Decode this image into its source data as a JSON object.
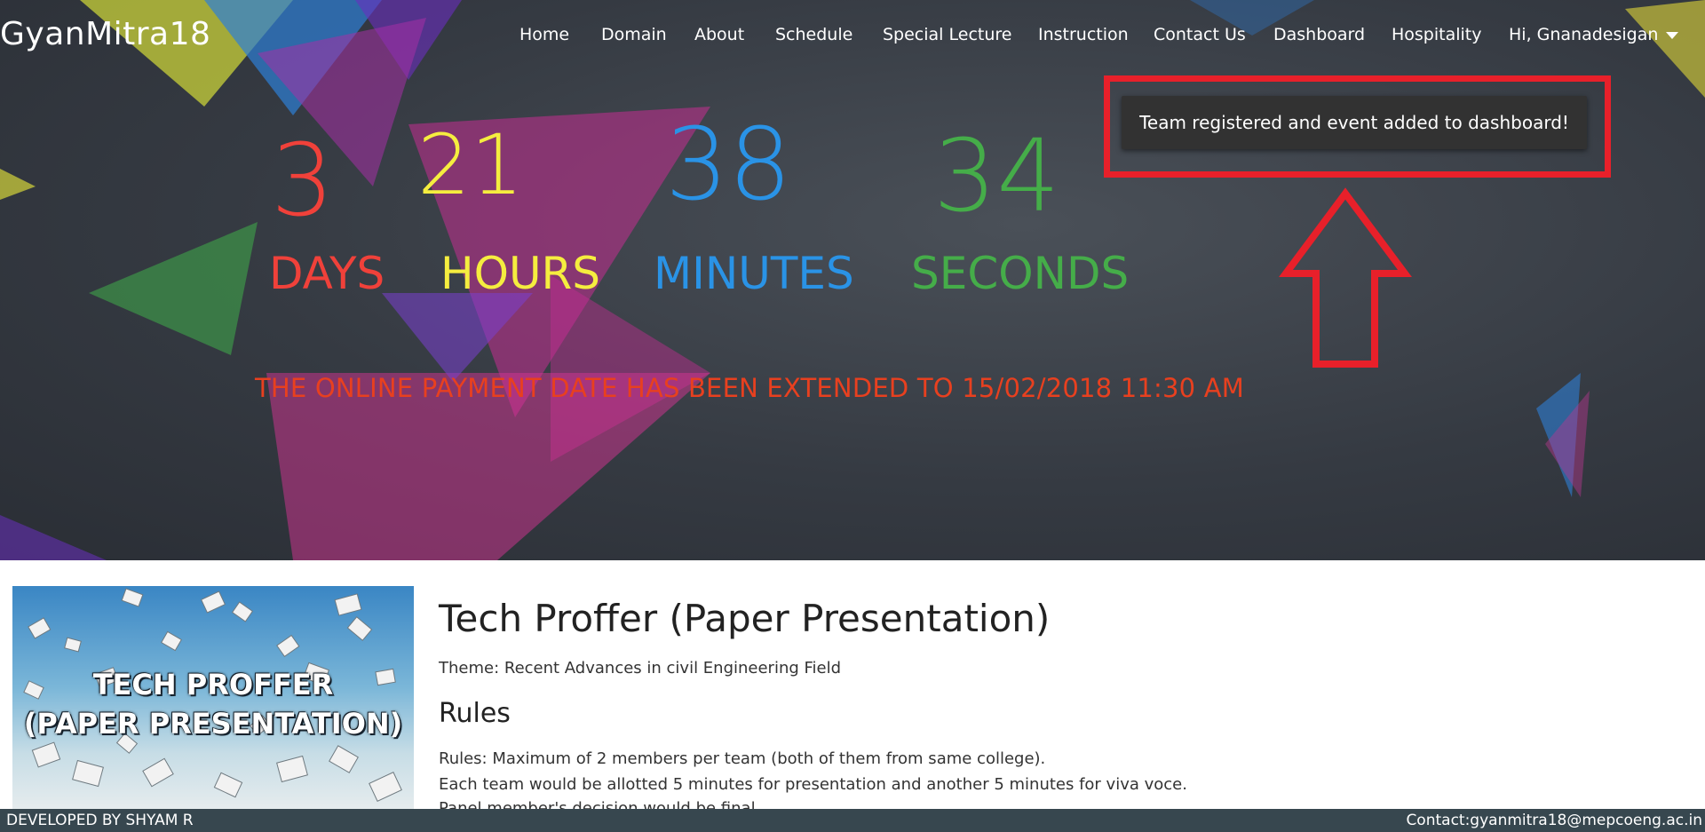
{
  "brand": "GyanMitra18",
  "nav": {
    "items": [
      "Home",
      "Domain",
      "About",
      "Schedule",
      "Special Lecture",
      "Instruction",
      "Contact Us",
      "Dashboard",
      "Hospitality"
    ],
    "user": "Hi, Gnanadesigan"
  },
  "countdown": {
    "days": {
      "value": "3",
      "label": "DAYS",
      "color": "#f0413a"
    },
    "hours": {
      "value": "21",
      "label": "HOURS",
      "color": "#f5ed3f"
    },
    "minutes": {
      "value": "38",
      "label": "MINUTES",
      "color": "#2a93e6"
    },
    "seconds": {
      "value": "34",
      "label": "SECONDS",
      "color": "#45ad49"
    }
  },
  "notice": "THE ONLINE PAYMENT DATE HAS BEEN EXTENDED TO 15/02/2018 11:30 AM",
  "toast": "Team registered and event added to dashboard!",
  "event": {
    "image_text": [
      "TECH PROFFER",
      "(PAPER PRESENTATION)"
    ],
    "title": "Tech Proffer (Paper Presentation)",
    "theme": "Theme: Recent Advances in civil Engineering Field",
    "rules_heading": "Rules",
    "rules": [
      "Rules: Maximum of 2 members per team (both of them from same college).",
      "Each team would be allotted 5 minutes for presentation and another 5 minutes for viva voce.",
      "Panel member's decision would be final."
    ]
  },
  "footer": {
    "left": "DEVELOPED BY SHYAM R",
    "right": "Contact:gyanmitra18@mepcoeng.ac.in"
  },
  "colors": {
    "accent_red": "#e8202a",
    "notice": "#e8401f",
    "footer_bg": "#37474f"
  }
}
